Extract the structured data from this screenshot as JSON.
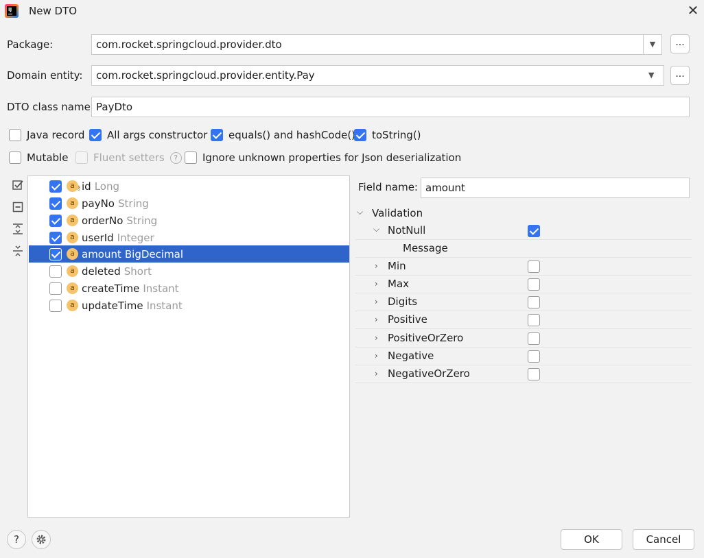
{
  "window": {
    "title": "New DTO"
  },
  "form": {
    "package_label": "Package:",
    "package_value": "com.rocket.springcloud.provider.dto",
    "domain_label": "Domain entity:",
    "domain_value": "com.rocket.springcloud.provider.entity.Pay",
    "dto_class_label": "DTO class name:",
    "dto_class_value": "PayDto",
    "browse_label": "..."
  },
  "options": {
    "java_record": {
      "label": "Java record",
      "checked": false
    },
    "all_args": {
      "label": "All args constructor",
      "checked": true
    },
    "equals_hash": {
      "label": "equals() and hashCode()",
      "checked": true
    },
    "to_string": {
      "label": "toString()",
      "checked": true
    },
    "mutable": {
      "label": "Mutable",
      "checked": false
    },
    "fluent": {
      "label": "Fluent setters",
      "checked": false,
      "disabled": true
    },
    "ignore_unknown": {
      "label": "Ignore unknown properties for Json deserialization",
      "checked": false
    }
  },
  "fields": [
    {
      "name": "id",
      "type": "Long",
      "checked": true,
      "key": true
    },
    {
      "name": "payNo",
      "type": "String",
      "checked": true
    },
    {
      "name": "orderNo",
      "type": "String",
      "checked": true
    },
    {
      "name": "userId",
      "type": "Integer",
      "checked": true
    },
    {
      "name": "amount",
      "type": "BigDecimal",
      "checked": true,
      "selected": true
    },
    {
      "name": "deleted",
      "type": "Short",
      "checked": false
    },
    {
      "name": "createTime",
      "type": "Instant",
      "checked": false
    },
    {
      "name": "updateTime",
      "type": "Instant",
      "checked": false
    }
  ],
  "field_icon_letter": "a",
  "details": {
    "field_name_label": "Field name:",
    "field_name_value": "amount",
    "validation_label": "Validation",
    "validations": [
      {
        "name": "NotNull",
        "checked": true,
        "expanded": true
      },
      {
        "name": "Message",
        "sub": true
      },
      {
        "name": "Min",
        "checked": false
      },
      {
        "name": "Max",
        "checked": false
      },
      {
        "name": "Digits",
        "checked": false
      },
      {
        "name": "Positive",
        "checked": false
      },
      {
        "name": "PositiveOrZero",
        "checked": false
      },
      {
        "name": "Negative",
        "checked": false
      },
      {
        "name": "NegativeOrZero",
        "checked": false
      }
    ]
  },
  "buttons": {
    "ok": "OK",
    "cancel": "Cancel",
    "help": "?"
  },
  "icons": {
    "app": "intellij-idea-icon",
    "close": "close-icon",
    "check_all": "select-all-icon",
    "uncheck_all": "deselect-all-icon",
    "expand": "expand-all-icon",
    "collapse": "collapse-all-icon",
    "settings": "gear-icon",
    "accent": "#3574f0",
    "selection": "#2f65ca"
  }
}
